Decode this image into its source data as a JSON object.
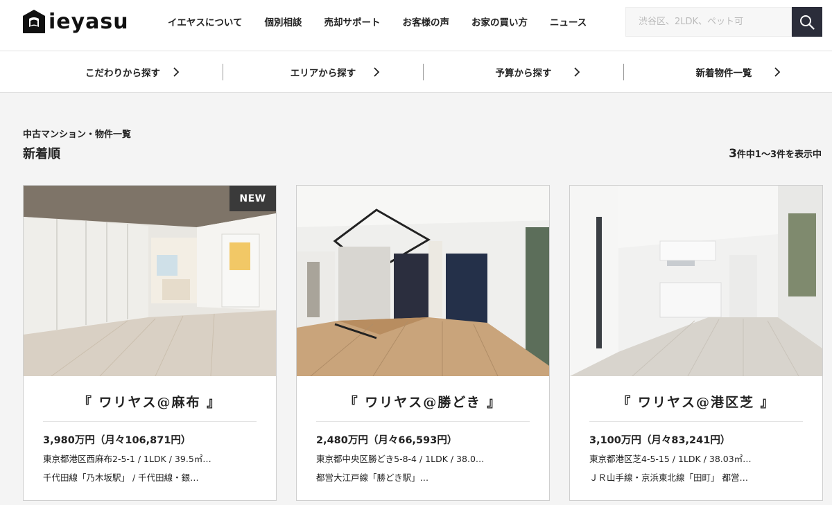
{
  "header": {
    "logo_text": "ieyasu",
    "nav": [
      {
        "label": "イエヤスについて"
      },
      {
        "label": "個別相談"
      },
      {
        "label": "売却サポート"
      },
      {
        "label": "お客様の声"
      },
      {
        "label": "お家の買い方"
      },
      {
        "label": "ニュース"
      }
    ],
    "search": {
      "placeholder": "渋谷区、2LDK、ペット可",
      "icon": "search-icon"
    }
  },
  "subnav": [
    {
      "label": "こだわりから探す",
      "icon": "chevron-right-icon"
    },
    {
      "label": "エリアから探す",
      "icon": "chevron-right-icon"
    },
    {
      "label": "予算から探す",
      "icon": "chevron-right-icon"
    },
    {
      "label": "新着物件一覧",
      "icon": "chevron-right-icon"
    }
  ],
  "listing": {
    "category_title": "中古マンション・物件一覧",
    "sort_label": "新着順",
    "count_number": "3",
    "count_text": "件中1〜3件を表示中"
  },
  "properties": [
    {
      "badge": "NEW",
      "title": "『 ワリヤス@麻布 』",
      "price": "3,980万円（月々106,871円）",
      "address": "東京都港区西麻布2-5-1 / 1LDK / 39.5㎡…",
      "line": "千代田線「乃木坂駅」 / 千代田線・銀…"
    },
    {
      "title": "『 ワリヤス@勝どき 』",
      "price": "2,480万円（月々66,593円）",
      "address": "東京都中央区勝どき5-8-4 / 1LDK / 38.0…",
      "line": "都営大江戸線「勝どき駅」…"
    },
    {
      "title": "『 ワリヤス@港区芝 』",
      "price": "3,100万円（月々83,241円）",
      "address": "東京都港区芝4-5-15 / 1LDK / 38.03㎡…",
      "line": "ＪＲ山手線・京浜東北線「田町」 都営…"
    }
  ],
  "colors": {
    "search_button": "#2b2d3a",
    "badge": "#3a3a3a",
    "background": "#f4f4f4"
  }
}
